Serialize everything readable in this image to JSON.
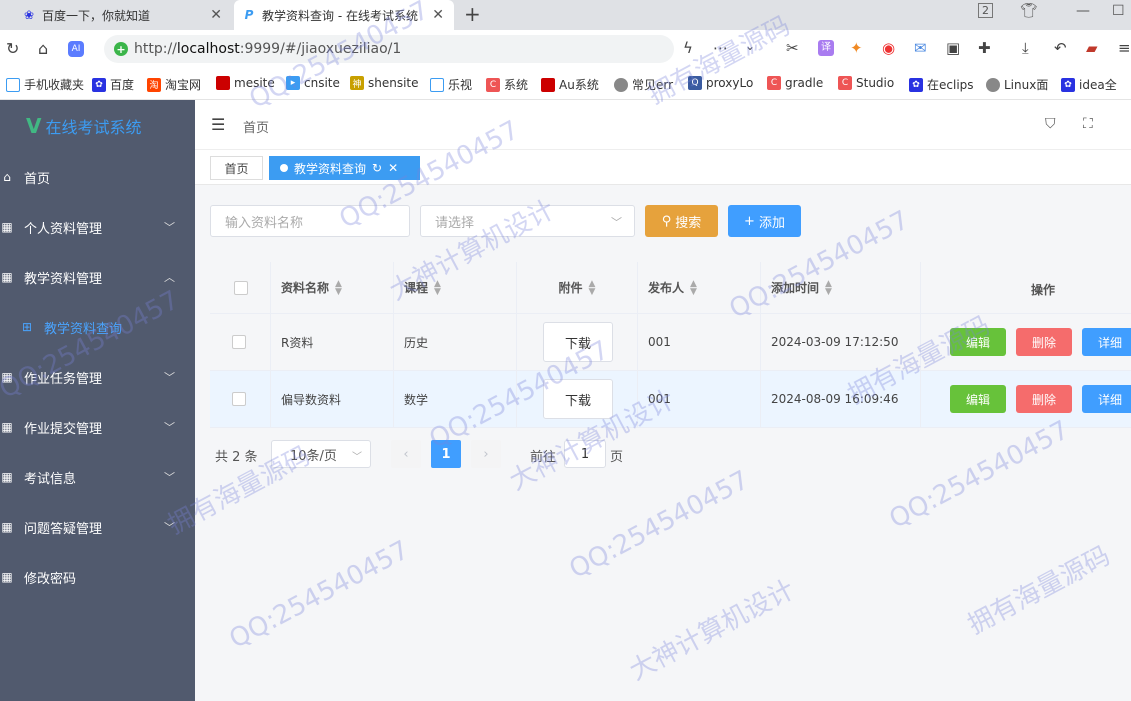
{
  "browser": {
    "tabs": [
      {
        "title": "百度一下，你就知道",
        "icon": "paw-icon"
      },
      {
        "title": "教学资料查询 - 在线考试系统",
        "icon": "p-logo-icon"
      }
    ],
    "url_scheme": "http://",
    "url_host": "localhost",
    "url_rest": ":9999/#/jiaoxueziliao/1",
    "tab_count": "2",
    "bookmarks": [
      "手机收藏夹",
      "百度",
      "淘宝网",
      "mesite",
      "cnsite",
      "shensite",
      "乐视",
      "系统",
      "Au系统",
      "常见err",
      "proxyLo",
      "gradle",
      "Studio",
      "在eclips",
      "Linux面",
      "idea全"
    ]
  },
  "app": {
    "logo": "在线考试系统",
    "menu": [
      {
        "label": "首页",
        "icon": "home-icon",
        "arrow": false
      },
      {
        "label": "个人资料管理",
        "icon": "grid-icon",
        "arrow": "down"
      },
      {
        "label": "教学资料管理",
        "icon": "grid-icon",
        "arrow": "up"
      },
      {
        "label": "教学资料查询",
        "icon": "apps-icon",
        "arrow": false,
        "sub": true
      },
      {
        "label": "作业任务管理",
        "icon": "grid-icon",
        "arrow": "down"
      },
      {
        "label": "作业提交管理",
        "icon": "grid-icon",
        "arrow": "down"
      },
      {
        "label": "考试信息",
        "icon": "grid-icon",
        "arrow": "down"
      },
      {
        "label": "问题答疑管理",
        "icon": "grid-icon",
        "arrow": "down"
      },
      {
        "label": "修改密码",
        "icon": "grid-icon",
        "arrow": false
      }
    ],
    "breadcrumb": "首页",
    "tags": [
      {
        "label": "首页",
        "active": false
      },
      {
        "label": "教学资料查询",
        "active": true
      }
    ]
  },
  "filters": {
    "name_placeholder": "输入资料名称",
    "select_placeholder": "请选择",
    "search_label": "搜索",
    "add_label": "添加"
  },
  "table": {
    "headers": [
      "资料名称",
      "课程",
      "附件",
      "发布人",
      "添加时间",
      "操作"
    ],
    "rows": [
      {
        "name": "R资料",
        "course": "历史",
        "attachment": "下载",
        "publisher": "001",
        "time": "2024-03-09 17:12:50"
      },
      {
        "name": "偏导数资料",
        "course": "数学",
        "attachment": "下载",
        "publisher": "001",
        "time": "2024-08-09 16:09:46"
      }
    ],
    "actions": {
      "edit": "编辑",
      "delete": "删除",
      "detail": "详细"
    }
  },
  "pagination": {
    "total_text": "共 2 条",
    "page_size": "10条/页",
    "current_page": "1",
    "goto_prefix": "前往",
    "goto_value": "1",
    "goto_suffix": "页"
  },
  "watermark": {
    "texts": [
      "QQ:254540457",
      "拥有海量源码",
      "大神计算机设计"
    ]
  },
  "colors": {
    "sidebar_bg": "#515a6e",
    "accent": "#409eff",
    "search": "#e6a23c",
    "edit": "#67c23a",
    "delete": "#f56c6c"
  }
}
